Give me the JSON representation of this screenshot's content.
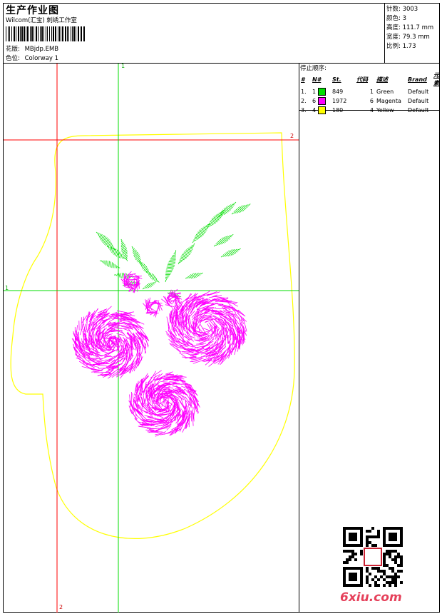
{
  "header": {
    "title": "生产作业图",
    "studio": "Wilcom(汇宝) 刺绣工作室",
    "design_label": "花版:",
    "design_value": "MBjdp.EMB",
    "colorway_label": "色位:",
    "colorway_value": "Colorway 1"
  },
  "stats": {
    "stitches": "针数: 3003",
    "colors": "颜色: 3",
    "height": "高度: 111.7 mm",
    "width": "宽度: 79.3 mm",
    "scale": "比例: 1.73"
  },
  "stop_sequence": {
    "heading": "停止顺序:",
    "columns": [
      "#",
      "N#",
      "St.",
      "代码",
      "描述",
      "Brand",
      "元素"
    ],
    "rows": [
      {
        "index": "1.",
        "needle": "1",
        "stitches": "849",
        "code": "1",
        "description": "Green",
        "brand": "Default",
        "color": "#00dd00"
      },
      {
        "index": "2.",
        "needle": "6",
        "stitches": "1972",
        "code": "6",
        "description": "Magenta",
        "brand": "Default",
        "color": "#ff00ff"
      },
      {
        "index": "3.",
        "needle": "4",
        "stitches": "180",
        "code": "4",
        "description": "Yellow",
        "brand": "Default",
        "color": "#ffff00"
      }
    ]
  },
  "guides": {
    "green_top": "1",
    "green_left": "1",
    "red_right": "2",
    "red_bottom": "2"
  },
  "watermark": "6xiu.com",
  "colors": {
    "green": "#00dd00",
    "magenta": "#ff00ff",
    "yellow": "#ffff00",
    "guide_red": "#ff0000",
    "guide_green": "#00dd00"
  }
}
